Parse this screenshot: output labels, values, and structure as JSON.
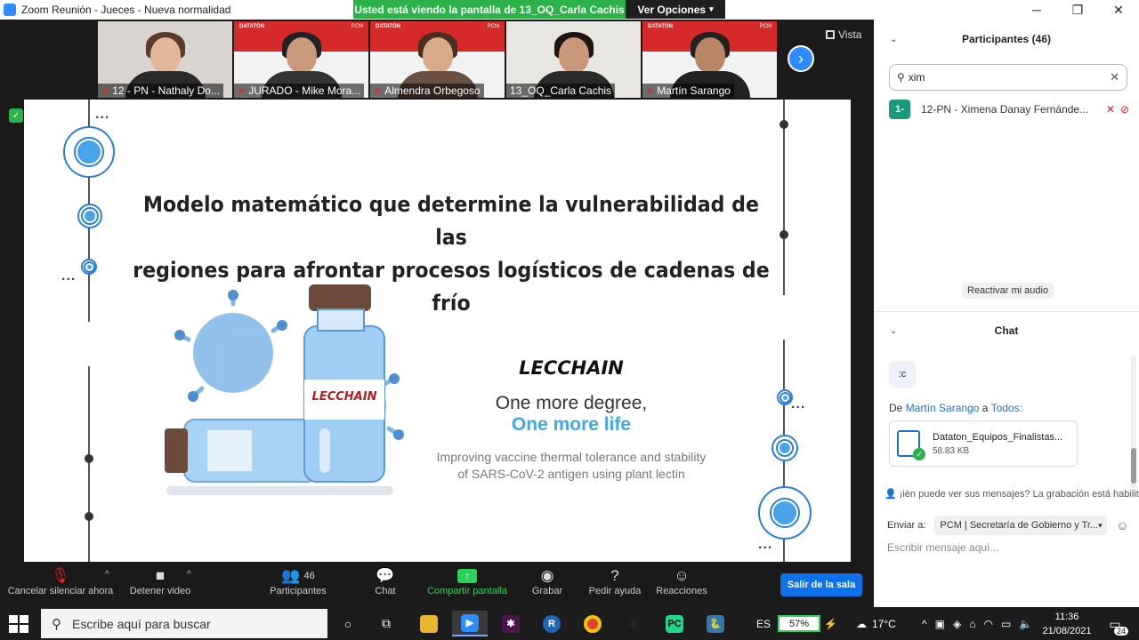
{
  "window": {
    "title": "Zoom Reunión - Jueces - Nueva normalidad"
  },
  "share_banner": {
    "text": "Usted está viendo la pantalla de 13_OQ_Carla Cachis",
    "options": "Ver Opciones"
  },
  "gallery": {
    "tiles": [
      {
        "name": "12 - PN - Nathaly Do...",
        "muted": true,
        "style": "girl"
      },
      {
        "name": "JURADO - Mike Mora...",
        "muted": true,
        "style": "datathon"
      },
      {
        "name": "Almendra Orbegoso",
        "muted": true,
        "style": "datathon2"
      },
      {
        "name": "13_OQ_Carla Cachis",
        "muted": false,
        "style": "active"
      },
      {
        "name": "Martín Sarango",
        "muted": true,
        "style": "datathon3"
      }
    ],
    "brand_left": "DATATÓN",
    "brand_right": "PCM",
    "view_label": "Vista"
  },
  "slide": {
    "title_line1": "Modelo matemático que determine la vulnerabilidad  de las",
    "title_line2": "regiones para afrontar procesos logísticos de cadenas de frío",
    "bottle_label": "LECCHAIN",
    "brand": "LECCHAIN",
    "tagline1": "One more degree,",
    "tagline2": "One more life",
    "description_line1": "Improving vaccine thermal tolerance and stability",
    "description_line2": "of SARS-CoV-2 antigen using plant lectin",
    "dots": "..."
  },
  "participants_panel": {
    "title": "Participantes (46)",
    "search_value": "xim",
    "rows": [
      {
        "avatar": "1-",
        "name": "12-PN - Ximena Danay Fernánde..."
      }
    ],
    "reactivate_label": "Reactivar mi audio"
  },
  "chat_panel": {
    "title": "Chat",
    "last_message": ":c",
    "from_prefix": "De",
    "from_user": "Martín Sarango",
    "to_word": "a",
    "to_target": "Todos:",
    "file_name": "Dataton_Equipos_Finalistas...",
    "file_size": "58.83 KB",
    "who_can_see": "¡ién puede ver sus mensajes? La grabación está habilit",
    "send_to_label": "Enviar a:",
    "send_to_value": "PCM | Secretaría de Gobierno y Tr...",
    "input_placeholder": "Escribir mensaje aquí..."
  },
  "toolbar": {
    "unmute": "Cancelar silenciar ahora",
    "stop_video": "Detener video",
    "participants": "Participantes",
    "participants_count": "46",
    "chat": "Chat",
    "share": "Compartir pantalla",
    "record": "Grabar",
    "help": "Pedir ayuda",
    "reactions": "Reacciones",
    "leave": "Salir de la sala"
  },
  "taskbar": {
    "search_placeholder": "Escribe aquí para buscar",
    "language": "ES",
    "battery": "57%",
    "temperature": "17°C",
    "time": "11:36",
    "date": "21/08/2021",
    "notifications": "24"
  },
  "colors": {
    "zoom_blue": "#2d8cff",
    "share_green": "#2bb34a",
    "datathon_red": "#d62a2a",
    "accent_blue": "#3ea8e8"
  }
}
